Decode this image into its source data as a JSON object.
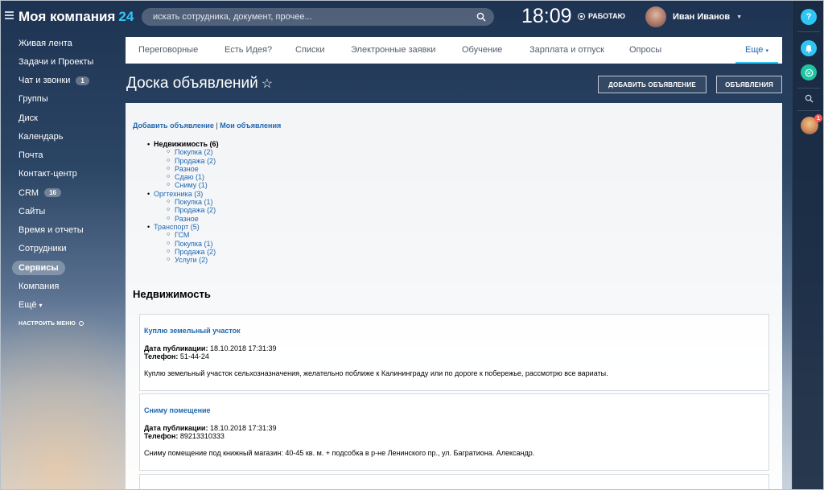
{
  "brand": {
    "name": "Моя компания",
    "suffix": "24"
  },
  "search": {
    "placeholder": "искать сотрудника, документ, прочее..."
  },
  "clock": {
    "time": "18:09",
    "status": "РАБОТАЮ"
  },
  "user": {
    "name": "Иван Иванов"
  },
  "menu": {
    "items": [
      {
        "label": "Живая лента"
      },
      {
        "label": "Задачи и Проекты"
      },
      {
        "label": "Чат и звонки",
        "badge": "1"
      },
      {
        "label": "Группы"
      },
      {
        "label": "Диск"
      },
      {
        "label": "Календарь"
      },
      {
        "label": "Почта"
      },
      {
        "label": "Контакт-центр"
      },
      {
        "label": "CRM",
        "badge": "16"
      },
      {
        "label": "Сайты"
      },
      {
        "label": "Время и отчеты"
      },
      {
        "label": "Сотрудники"
      },
      {
        "label": "Сервисы",
        "active": true
      },
      {
        "label": "Компания"
      },
      {
        "label": "Ещё"
      }
    ],
    "setup_label": "НАСТРОИТЬ МЕНЮ"
  },
  "topnav": {
    "tabs": [
      "Переговорные",
      "Есть Идея?",
      "Списки",
      "Электронные заявки",
      "Обучение",
      "Зарплата и отпуск",
      "Опросы",
      "Еще"
    ]
  },
  "page": {
    "title": "Доска объявлений",
    "add_button": "ДОБАВИТЬ ОБЪЯВЛЕНИЕ",
    "ads_button": "ОБЪЯВЛЕНИЯ"
  },
  "links": {
    "add": "Добавить объявление",
    "separator": "|",
    "mine": "Мои объявления"
  },
  "categories": [
    {
      "label": "Недвижимость (6)",
      "bold": true,
      "subs": [
        "Покупка (2)",
        "Продажа (2)",
        "Разное",
        "Сдаю (1)",
        "Сниму (1)"
      ]
    },
    {
      "label": "Оргтехника (3)",
      "subs": [
        "Покупка (1)",
        "Продажа (2)",
        "Разное"
      ]
    },
    {
      "label": "Транспорт (5)",
      "subs": [
        "ГСМ",
        "Покупка (1)",
        "Продажа (2)",
        "Услуги (2)"
      ]
    }
  ],
  "section_title": "Недвижимость",
  "ads": [
    {
      "title": "Куплю земельный участок",
      "date_label": "Дата публикации:",
      "date": "18.10.2018 17:31:39",
      "phone_label": "Телефон:",
      "phone": "51-44-24",
      "text": "Куплю земельный участок сельхозназначения, желательно поближе к Калининграду или по дороге к побережье, рассмотрю все вариаты."
    },
    {
      "title": "Сниму помещение",
      "date_label": "Дата публикации:",
      "date": "18.10.2018 17:31:39",
      "phone_label": "Телефон:",
      "phone": "89213310333",
      "text": "Сниму помещение под книжный магазин: 40-45 кв. м. + подсобка в р-не Ленинского пр., ул. Багратиона. Александр."
    }
  ],
  "rail": {
    "help": "?",
    "notif_count": "1"
  },
  "colors": {
    "accent": "#2fc6f6",
    "link": "#2067b0",
    "rail_help": "#2fc6f6",
    "rail_bell": "#2fc6f6",
    "rail_chat": "#1ec5a0"
  }
}
